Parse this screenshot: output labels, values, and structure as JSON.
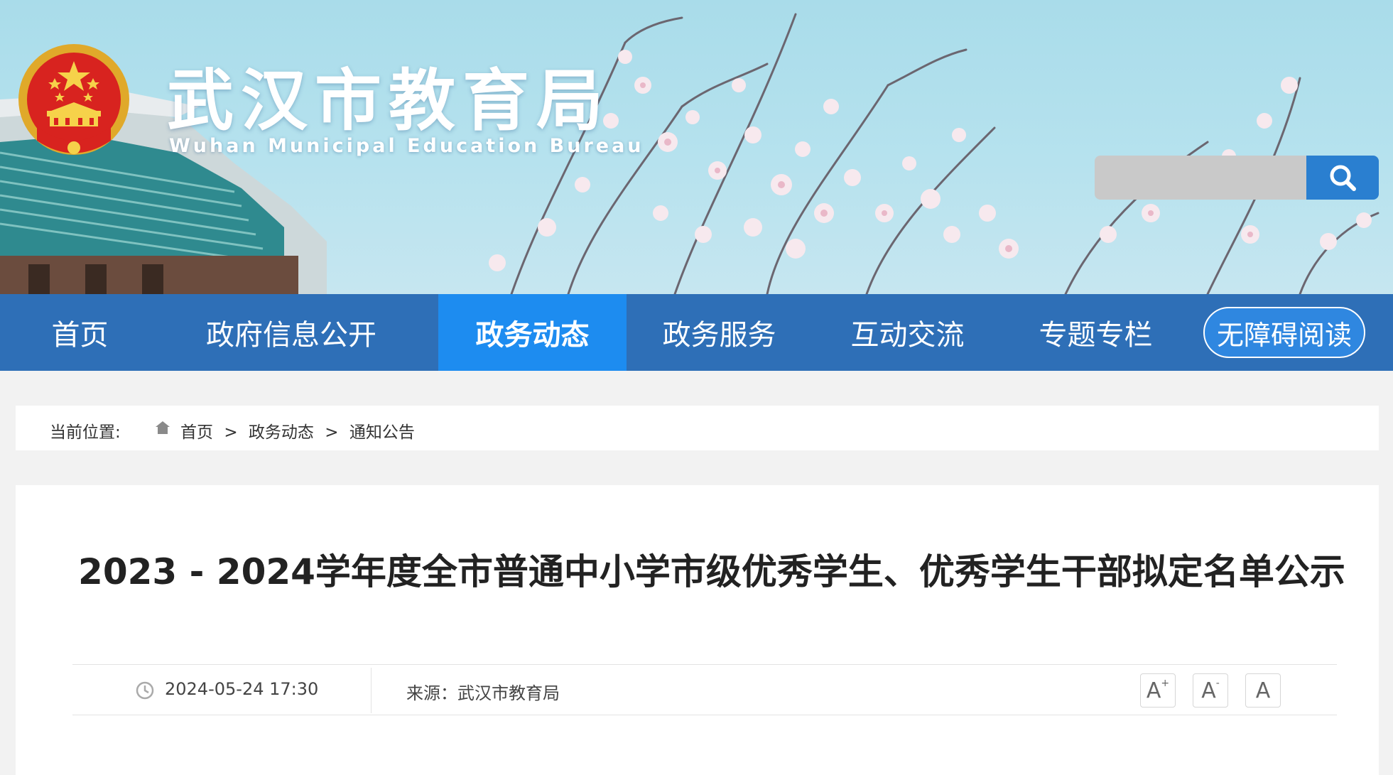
{
  "header": {
    "title": "武汉市教育局",
    "subtitle": "Wuhan Municipal Education Bureau",
    "search": {
      "placeholder": "",
      "value": ""
    }
  },
  "nav": {
    "items": [
      {
        "label": "首页"
      },
      {
        "label": "政府信息公开"
      },
      {
        "label": "政务动态",
        "active": true
      },
      {
        "label": "政务服务"
      },
      {
        "label": "互动交流"
      },
      {
        "label": "专题专栏"
      }
    ],
    "accessibility_label": "无障碍阅读"
  },
  "breadcrumb": {
    "label": "当前位置:",
    "items": [
      "首页",
      "政务动态",
      "通知公告"
    ],
    "separator": ">"
  },
  "article": {
    "title": "2023 - 2024学年度全市普通中小学市级优秀学生、优秀学生干部拟定名单公示",
    "date": "2024-05-24 17:30",
    "source": "来源：武汉市教育局",
    "font_controls": [
      "A+",
      "A-",
      "A"
    ]
  },
  "colors": {
    "nav_bg": "#2e6fb7",
    "nav_active": "#1d8cf0",
    "search_button": "#2a7fd0",
    "banner_sky": "#b6e2ee"
  }
}
